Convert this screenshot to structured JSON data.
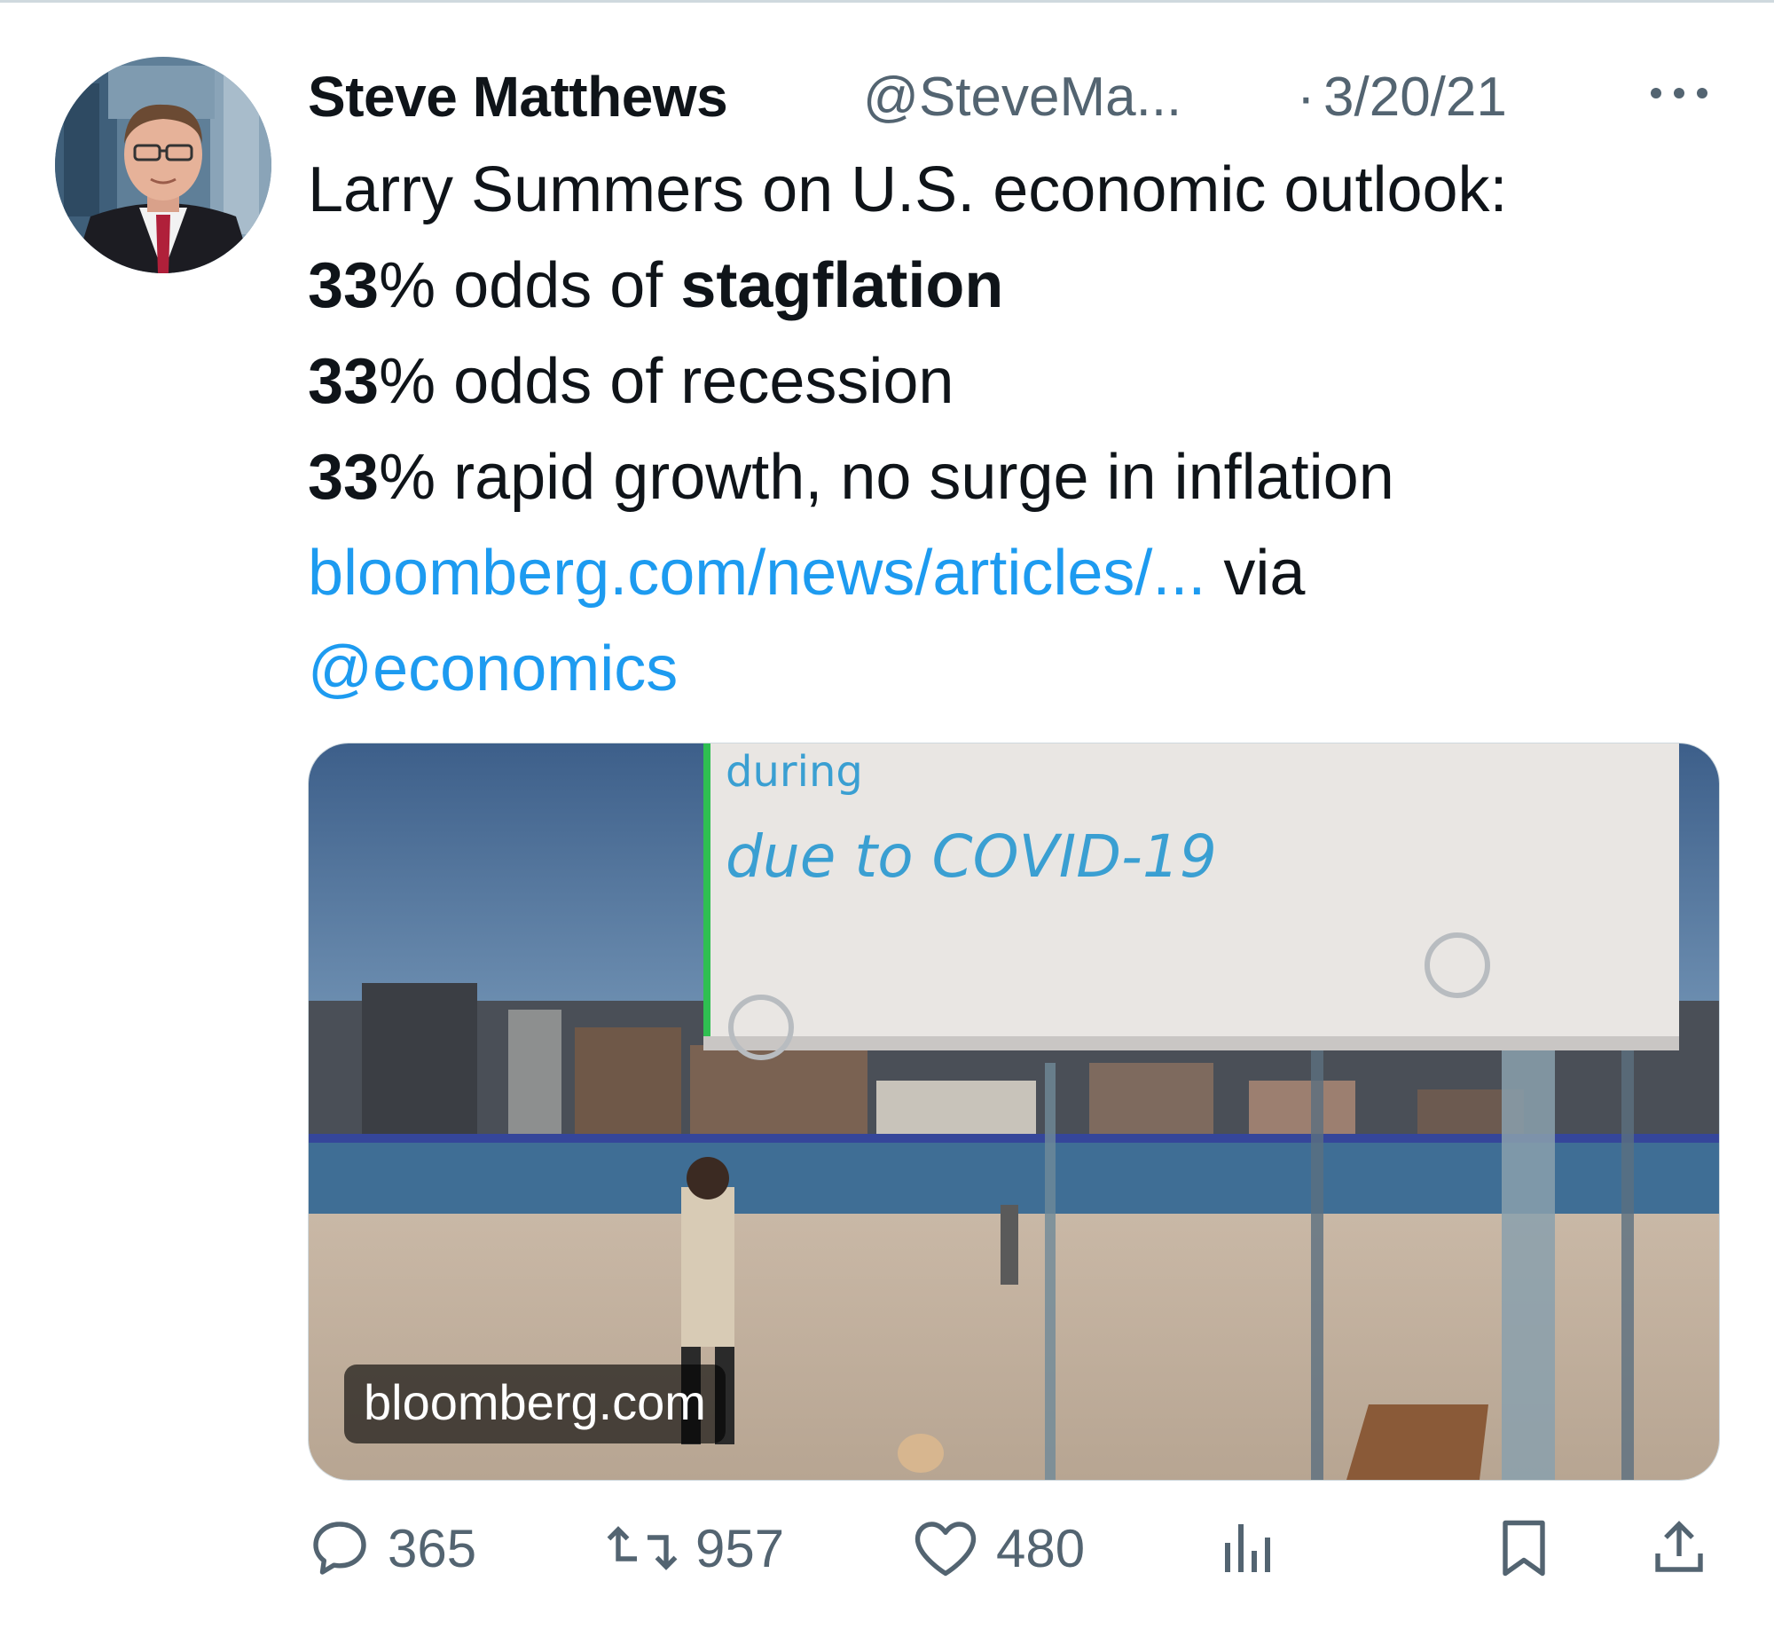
{
  "author": {
    "name": "Steve Matthews",
    "handle": "@SteveMa...",
    "separator": "·",
    "date": "3/20/21"
  },
  "tweet": {
    "line1": "Larry Summers on U.S. economic outlook:",
    "line2_bold": "33",
    "line2_pct": "% odds of ",
    "line2_bold_word": "stagflation",
    "line3_bold": "33",
    "line3_rest": "% odds of recession",
    "line4_bold": "33",
    "line4_rest": "% rapid growth, no surge in inflation",
    "link": "bloomberg.com/news/articles/...",
    "via": " via",
    "mention": "@economics"
  },
  "card": {
    "domain": "bloomberg.com",
    "sign_text_top": "during",
    "sign_text": "due to COVID-19"
  },
  "actions": {
    "replies": "365",
    "retweets": "957",
    "likes": "480"
  },
  "icons": {
    "more": "more-icon",
    "reply": "reply-icon",
    "retweet": "retweet-icon",
    "like": "heart-icon",
    "views": "analytics-icon",
    "bookmark": "bookmark-icon",
    "share": "share-icon"
  },
  "colors": {
    "link": "#1d9bf0",
    "secondary_text": "#536471",
    "primary_text": "#0f1419"
  }
}
